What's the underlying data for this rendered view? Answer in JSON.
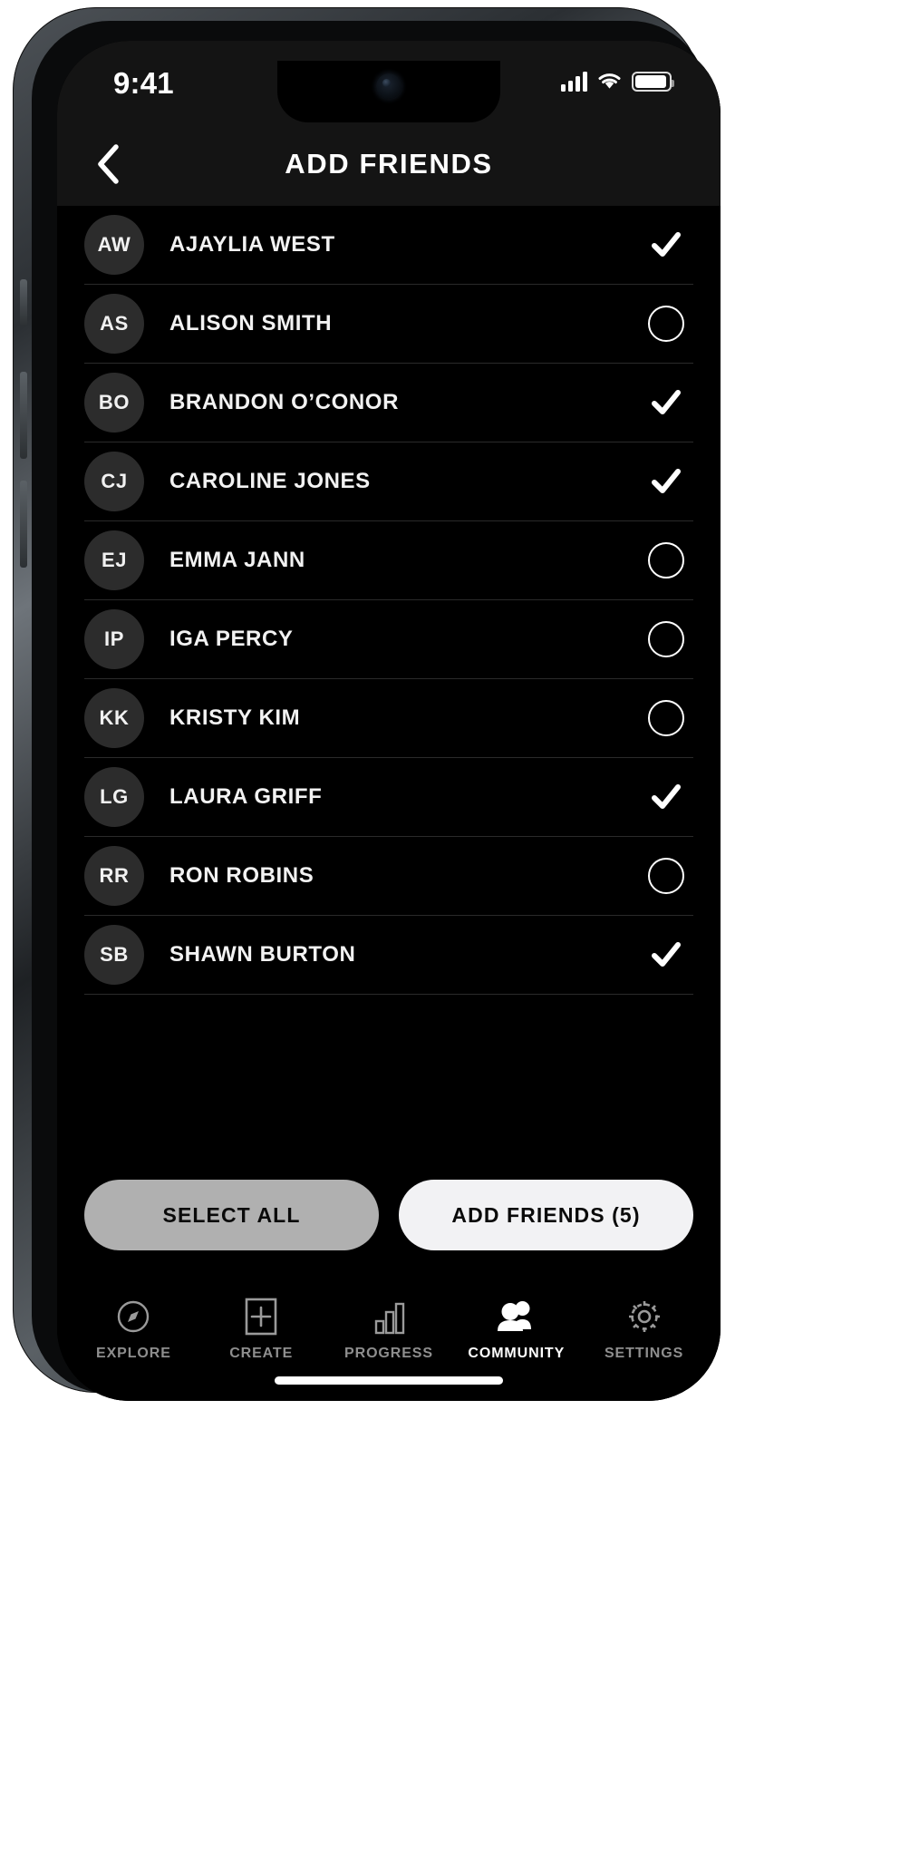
{
  "statusbar": {
    "time": "9:41",
    "cellular_icon": "cellular-signal-icon",
    "wifi_icon": "wifi-icon",
    "battery_icon": "battery-icon"
  },
  "header": {
    "title": "ADD FRIENDS",
    "back_icon": "chevron-left-icon"
  },
  "colors": {
    "background": "#000000",
    "header_bg": "#141414",
    "avatar_bg": "#2c2c2c",
    "divider": "#2a2a2a",
    "text": "#f2f2f2",
    "primary_button": "#f2f2f4",
    "secondary_button": "#b0b0b0",
    "tab_inactive": "#8e8e8e",
    "tab_active": "#ffffff"
  },
  "friends": [
    {
      "initials": "AW",
      "name": "AJAYLIA WEST",
      "selected": true
    },
    {
      "initials": "AS",
      "name": "ALISON SMITH",
      "selected": false
    },
    {
      "initials": "BO",
      "name": "BRANDON O’CONOR",
      "selected": true
    },
    {
      "initials": "CJ",
      "name": "CAROLINE JONES",
      "selected": true
    },
    {
      "initials": "EJ",
      "name": "EMMA JANN",
      "selected": false
    },
    {
      "initials": "IP",
      "name": "IGA PERCY",
      "selected": false
    },
    {
      "initials": "KK",
      "name": "KRISTY KIM",
      "selected": false
    },
    {
      "initials": "LG",
      "name": "LAURA GRIFF",
      "selected": true
    },
    {
      "initials": "RR",
      "name": "RON ROBINS",
      "selected": false
    },
    {
      "initials": "SB",
      "name": "SHAWN BURTON",
      "selected": true
    }
  ],
  "actions": {
    "select_all_label": "SELECT ALL",
    "add_friends_label": "ADD FRIENDS (5)",
    "selected_count": 5
  },
  "tabbar": {
    "items": [
      {
        "label": "EXPLORE",
        "icon": "compass-icon",
        "active": false
      },
      {
        "label": "CREATE",
        "icon": "square-plus-icon",
        "active": false
      },
      {
        "label": "PROGRESS",
        "icon": "bar-chart-icon",
        "active": false
      },
      {
        "label": "COMMUNITY",
        "icon": "people-icon",
        "active": true
      },
      {
        "label": "SETTINGS",
        "icon": "gear-icon",
        "active": false
      }
    ]
  }
}
